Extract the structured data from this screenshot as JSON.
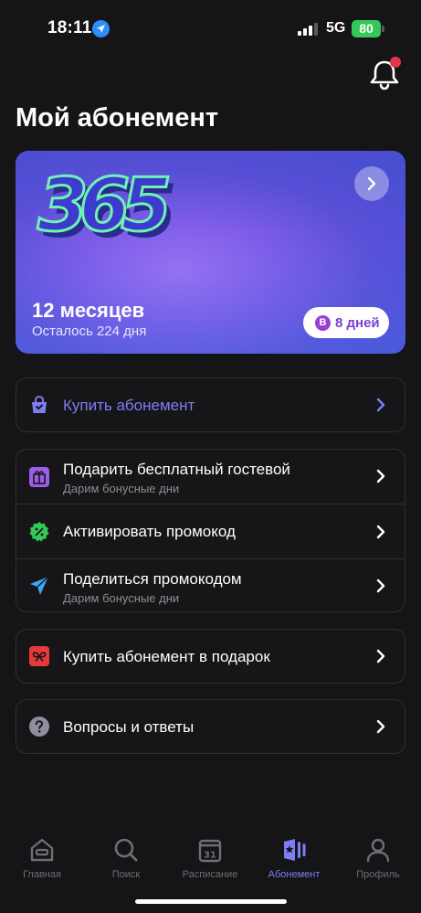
{
  "status_bar": {
    "time": "18:11",
    "network": "5G",
    "battery": "80"
  },
  "page": {
    "title": "Мой абонемент"
  },
  "card": {
    "logo_text": "365",
    "months": "12 месяцев",
    "remaining": "Осталось 224 дня",
    "badge_letter": "B",
    "badge_text": "8 дней"
  },
  "menu": {
    "buy": {
      "title": "Купить абонемент"
    },
    "gift_guest": {
      "title": "Подарить бесплатный гостевой",
      "subtitle": "Дарим бонусные дни"
    },
    "activate_promo": {
      "title": "Активировать промокод"
    },
    "share_promo": {
      "title": "Поделиться промокодом",
      "subtitle": "Дарим бонусные дни"
    },
    "buy_gift": {
      "title": "Купить абонемент в подарок"
    },
    "faq": {
      "title": "Вопросы и ответы"
    }
  },
  "tabs": [
    {
      "label": "Главная",
      "icon": "home-icon"
    },
    {
      "label": "Поиск",
      "icon": "search-icon"
    },
    {
      "label": "Расписание",
      "icon": "calendar-icon",
      "calendar_day": "31"
    },
    {
      "label": "Абонемент",
      "icon": "membership-icon"
    },
    {
      "label": "Профиль",
      "icon": "profile-icon"
    }
  ],
  "colors": {
    "accent": "#7d7df5",
    "background": "#151517",
    "notification_dot": "#e3344d",
    "battery": "#34c759",
    "gift_icon": "#9b5ce8",
    "promo_icon": "#34c759",
    "share_icon": "#3aa8f5",
    "gift_sub_icon": "#e83a3a",
    "faq_icon": "#8e8ea0"
  }
}
